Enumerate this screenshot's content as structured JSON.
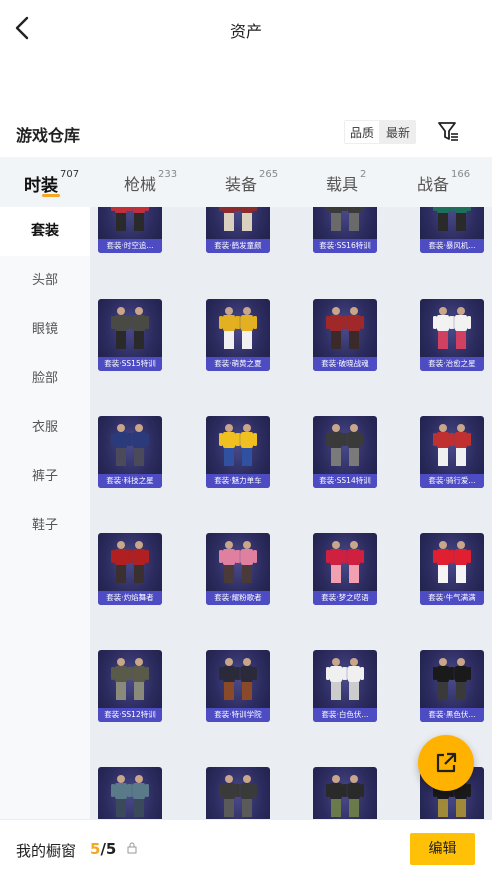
{
  "header": {
    "title": "资产"
  },
  "warehouse": {
    "title": "游戏仓库",
    "sort_options": [
      "品质",
      "最新"
    ],
    "active_sort_index": 0
  },
  "tabs": [
    {
      "label": "时装",
      "count": "707",
      "active": true
    },
    {
      "label": "枪械",
      "count": "233",
      "active": false
    },
    {
      "label": "装备",
      "count": "265",
      "active": false
    },
    {
      "label": "载具",
      "count": "2",
      "active": false
    },
    {
      "label": "战备",
      "count": "166",
      "active": false
    }
  ],
  "sidebar": {
    "items": [
      {
        "label": "套装",
        "active": true
      },
      {
        "label": "头部",
        "active": false
      },
      {
        "label": "眼镜",
        "active": false
      },
      {
        "label": "脸部",
        "active": false
      },
      {
        "label": "衣服",
        "active": false
      },
      {
        "label": "裤子",
        "active": false
      },
      {
        "label": "鞋子",
        "active": false
      }
    ]
  },
  "items": [
    {
      "caption": "套装·时空追...",
      "colors": [
        "#c0303a",
        "#2a2a2a"
      ]
    },
    {
      "caption": "套装·鹤发童颜",
      "colors": [
        "#8c2b2b",
        "#d9d0c0"
      ]
    },
    {
      "caption": "套装·SS16特训",
      "colors": [
        "#3a3a3a",
        "#6a6a6a"
      ]
    },
    {
      "caption": "套装·暴风机...",
      "colors": [
        "#1f6f5a",
        "#2a2a2a"
      ]
    },
    {
      "caption": "套装·SS15特训",
      "colors": [
        "#4a4a44",
        "#2a2a2a"
      ]
    },
    {
      "caption": "套装·萌黄之夏",
      "colors": [
        "#e2b020",
        "#f0f0f0"
      ]
    },
    {
      "caption": "套装·破晓战魂",
      "colors": [
        "#a02828",
        "#3a2a2a"
      ]
    },
    {
      "caption": "套装·治愈之星",
      "colors": [
        "#f2f2f2",
        "#d04060"
      ]
    },
    {
      "caption": "套装·科技之星",
      "colors": [
        "#2a3a7a",
        "#4a4a5a"
      ]
    },
    {
      "caption": "套装·魅力单车",
      "colors": [
        "#f0c020",
        "#3050a0"
      ]
    },
    {
      "caption": "套装·SS14特训",
      "colors": [
        "#3a3a3a",
        "#7a7a7a"
      ]
    },
    {
      "caption": "套装·骑行爱...",
      "colors": [
        "#c03030",
        "#f0f0f0"
      ]
    },
    {
      "caption": "套装·灼焰舞者",
      "colors": [
        "#b02020",
        "#3a3030"
      ]
    },
    {
      "caption": "套装·耀粉歌者",
      "colors": [
        "#e080a0",
        "#4a3a3a"
      ]
    },
    {
      "caption": "套装·梦之呓语",
      "colors": [
        "#d02040",
        "#f0a0b0"
      ]
    },
    {
      "caption": "套装·牛气满满",
      "colors": [
        "#e02030",
        "#f5f5f5"
      ]
    },
    {
      "caption": "套装·SS12特训",
      "colors": [
        "#5a5a4a",
        "#8a8a7a"
      ]
    },
    {
      "caption": "套装·特训学院",
      "colors": [
        "#2a2a3a",
        "#8a4a2a"
      ]
    },
    {
      "caption": "套装·白色伏...",
      "colors": [
        "#f0f0f0",
        "#cccccc"
      ]
    },
    {
      "caption": "套装·黑色伏...",
      "colors": [
        "#1a1a1a",
        "#3a3a3a"
      ]
    },
    {
      "caption": "",
      "colors": [
        "#5a7a8a",
        "#3a4a5a"
      ]
    },
    {
      "caption": "",
      "colors": [
        "#3a3a3a",
        "#5a5a5a"
      ]
    },
    {
      "caption": "",
      "colors": [
        "#2a2a2a",
        "#6a7a4a"
      ]
    },
    {
      "caption": "",
      "colors": [
        "#1a1a1a",
        "#a08a3a"
      ]
    }
  ],
  "bottom": {
    "showcase_label": "我的橱窗",
    "showcase_used": "5",
    "showcase_total": "/5",
    "edit_label": "编辑"
  },
  "colors": {
    "accent": "#f5a623",
    "button": "#ffc107",
    "caption_bar": "#4d4cc2"
  }
}
